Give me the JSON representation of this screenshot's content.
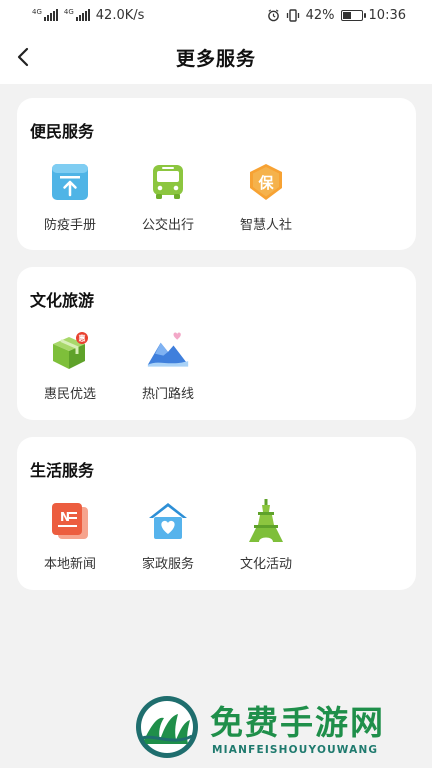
{
  "status_bar": {
    "signal_1_tag": "4G",
    "signal_2_tag": "4G",
    "net_speed": "42.0K/s",
    "battery_pct": "42%",
    "time": "10:36"
  },
  "header": {
    "title": "更多服务"
  },
  "sections": [
    {
      "title": "便民服务",
      "items": [
        {
          "label": "防疫手册",
          "icon": "epidemic-handbook-icon"
        },
        {
          "label": "公交出行",
          "icon": "bus-icon"
        },
        {
          "label": "智慧人社",
          "icon": "social-security-icon"
        }
      ]
    },
    {
      "title": "文化旅游",
      "items": [
        {
          "label": "惠民优选",
          "icon": "gift-box-icon"
        },
        {
          "label": "热门路线",
          "icon": "mountain-route-icon"
        }
      ]
    },
    {
      "title": "生活服务",
      "items": [
        {
          "label": "本地新闻",
          "icon": "news-icon"
        },
        {
          "label": "家政服务",
          "icon": "home-service-icon"
        },
        {
          "label": "文化活动",
          "icon": "tower-icon"
        }
      ]
    }
  ],
  "watermark": {
    "text": "免费手游网",
    "subtext": "MIANFEISHOUYOUWANG"
  },
  "colors": {
    "page_bg": "#f2f2f2",
    "card_bg": "#ffffff",
    "brand_green": "#1f8f4a"
  }
}
